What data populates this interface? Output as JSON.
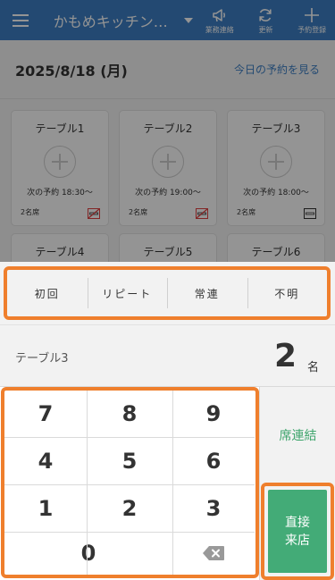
{
  "topbar": {
    "store_name": "かもめキッチン…",
    "buttons": [
      {
        "label": "業務連絡",
        "icon": "megaphone-icon"
      },
      {
        "label": "更新",
        "icon": "refresh-icon"
      },
      {
        "label": "予約登録",
        "icon": "plus-icon"
      }
    ]
  },
  "datebar": {
    "date": "2025/8/18 (月)",
    "today_link": "今日の予約を見る"
  },
  "tables": [
    {
      "name": "テーブル1",
      "next": "次の予約 18:30～",
      "seats": "2名席",
      "status_icon": "no-smoking-icon"
    },
    {
      "name": "テーブル2",
      "next": "次の予約 19:00～",
      "seats": "2名席",
      "status_icon": "no-smoking-icon"
    },
    {
      "name": "テーブル3",
      "next": "次の予約 18:00～",
      "seats": "2名席",
      "status_icon": "smoking-icon"
    },
    {
      "name": "テーブル4"
    },
    {
      "name": "テーブル5"
    },
    {
      "name": "テーブル6"
    }
  ],
  "customer_types": [
    "初回",
    "リピート",
    "常連",
    "不明"
  ],
  "selection": {
    "table": "テーブル3",
    "count": "2",
    "unit": "名"
  },
  "keypad": {
    "keys": [
      "7",
      "8",
      "9",
      "4",
      "5",
      "6",
      "1",
      "2",
      "3",
      "0"
    ],
    "backspace_icon": "backspace-icon"
  },
  "actions": {
    "join_label": "席連結",
    "walkin_line1": "直接",
    "walkin_line2": "来店"
  },
  "colors": {
    "header_blue": "#3d7fc4",
    "highlight_orange": "#ef7f2d",
    "action_green": "#43ab77"
  }
}
